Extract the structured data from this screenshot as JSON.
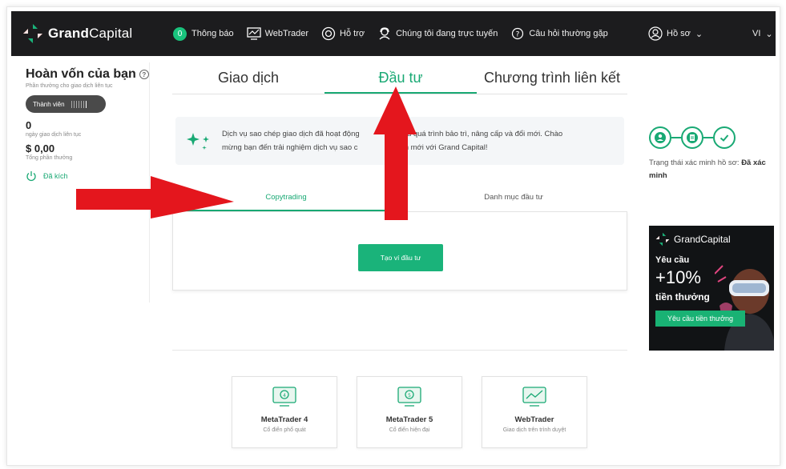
{
  "brand": {
    "name_bold": "Grand",
    "name_light": "Capital"
  },
  "nav": {
    "notif_count": "0",
    "notifications": "Thông báo",
    "webtrader": "WebTrader",
    "support": "Hỗ trợ",
    "online": "Chúng tôi đang trực tuyến",
    "faq": "Câu hỏi thường gặp",
    "profile": "Hồ sơ",
    "lang": "VI"
  },
  "sidebar": {
    "title": "Hoàn vốn của bạn",
    "subtitle": "Phần thưởng cho giao dịch liên tục",
    "member": "Thành viên",
    "days_value": "0",
    "days_label": "ngày giao dịch liên tục",
    "total_value": "$ 0,00",
    "total_label": "Tổng phần thưởng",
    "activated": "Đã kích"
  },
  "tabs": {
    "trade": "Giao dịch",
    "invest": "Đầu tư",
    "affiliate": "Chương trình liên kết"
  },
  "info": {
    "line1": "Dịch vụ sao chép giao dịch đã hoạt động",
    "line1b": "au quá trình bảo trì, nâng cấp và đổi mới. Chào",
    "line2": "mừng bạn đến trải nghiệm dịch vụ sao c",
    "line2b": "dịch mới với Grand Capital!"
  },
  "subtabs": {
    "copytrading": "Copytrading",
    "portfolio": "Danh mục đầu tư"
  },
  "create_button": "Tạo ví đầu tư",
  "platforms": [
    {
      "title": "MetaTrader 4",
      "sub": "Cổ điển phổ quát"
    },
    {
      "title": "MetaTrader 5",
      "sub": "Cổ điển hiện đại"
    },
    {
      "title": "WebTrader",
      "sub": "Giao dịch trên trình duyệt"
    }
  ],
  "verify": {
    "label": "Trạng thái xác minh hồ sơ: ",
    "status": "Đã xác minh"
  },
  "promo": {
    "brand": "GrandCapital",
    "l1": "Yêu cầu",
    "l2": "+10%",
    "l3": "tiền thưởng",
    "button": "Yêu cầu tiền thưởng"
  },
  "colors": {
    "accent": "#19a974",
    "topbar": "#1c1c1e",
    "arrow": "#e4161d"
  }
}
